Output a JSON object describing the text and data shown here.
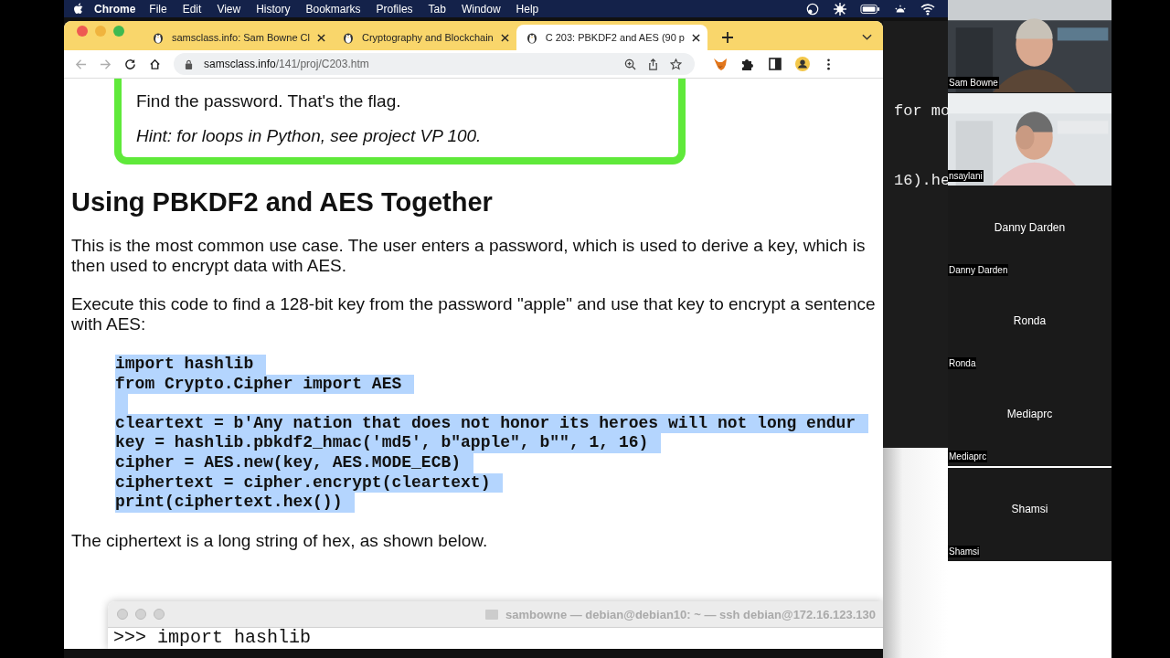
{
  "menu_bar": {
    "app": "Chrome",
    "items": [
      "File",
      "Edit",
      "View",
      "History",
      "Bookmarks",
      "Profiles",
      "Tab",
      "Window",
      "Help"
    ]
  },
  "browser": {
    "tabs": [
      {
        "title": "samsclass.info: Sam Bowne Cl",
        "selected": false
      },
      {
        "title": "Cryptography and Blockchain",
        "selected": false
      },
      {
        "title": "C 203: PBKDF2 and AES (90 p",
        "selected": true
      }
    ],
    "address": {
      "domain": "samsclass.info",
      "path": "/141/proj/C203.htm"
    }
  },
  "page": {
    "callout": {
      "text": "Find the password. That's the flag.",
      "hint": "Hint: for loops in Python, see project VP 100."
    },
    "heading": "Using PBKDF2 and AES Together",
    "paragraphs": [
      "This is the most common use case. The user enters a password, which is used to derive a key, which is then used to encrypt data with AES.",
      "Execute this code to find a 128-bit key from the password \"apple\" and use that key to encrypt a sentence with AES:"
    ],
    "code": {
      "selected": true,
      "blocks": [
        {
          "lines": [
            "import hashlib",
            "from Crypto.Cipher import AES"
          ]
        },
        {
          "lines": [
            "cleartext = b'Any nation that does not honor its heroes will not long endur",
            "key = hashlib.pbkdf2_hmac('md5', b\"apple\", b\"\", 1, 16)",
            "cipher = AES.new(key, AES.MODE_ECB)",
            "ciphertext = cipher.encrypt(cleartext)",
            "print(ciphertext.hex())"
          ]
        }
      ]
    },
    "closing": "The ciphertext is a long string of hex, as shown below."
  },
  "terminal": {
    "title": "sambowne — debian@debian10: ~ — ssh debian@172.16.123.130",
    "line": ">>> import hashlib"
  },
  "background_terminal": {
    "lines": [
      "for mo",
      "16).he"
    ]
  },
  "participants": [
    {
      "kind": "video",
      "caption": "Sam Bowne"
    },
    {
      "kind": "video",
      "caption": "nsaylani"
    },
    {
      "kind": "avatar",
      "name": "Danny Darden",
      "caption": "Danny Darden"
    },
    {
      "kind": "avatar",
      "name": "Ronda",
      "caption": "Ronda"
    },
    {
      "kind": "avatar",
      "name": "Mediaprc",
      "caption": "Mediaprc"
    },
    {
      "kind": "avatar",
      "name": "Shamsi",
      "caption": "Shamsi"
    }
  ]
}
